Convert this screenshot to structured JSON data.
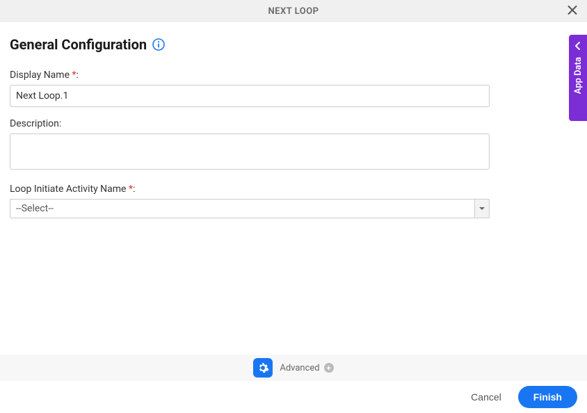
{
  "header": {
    "title": "NEXT LOOP"
  },
  "section": {
    "title": "General Configuration"
  },
  "fields": {
    "displayName": {
      "label": "Display Name",
      "required": "*",
      "colon": ":",
      "value": "Next Loop.1"
    },
    "description": {
      "label": "Description:",
      "value": ""
    },
    "loopInitiate": {
      "label": "Loop Initiate Activity Name",
      "required": "*",
      "colon": ":",
      "selected": "--Select--"
    }
  },
  "advanced": {
    "label": "Advanced"
  },
  "sideTab": {
    "label": "App Data"
  },
  "footer": {
    "cancel": "Cancel",
    "finish": "Finish"
  }
}
